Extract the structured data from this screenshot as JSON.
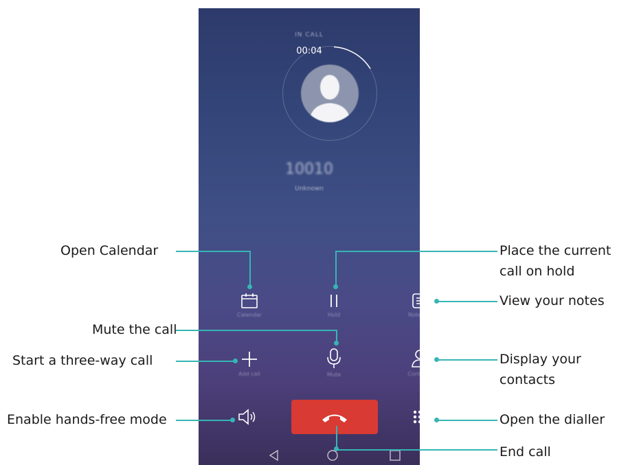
{
  "call": {
    "status": "IN CALL",
    "duration": "00:04",
    "number": "10010",
    "number_label": "Unknown"
  },
  "controls": {
    "calendar": {
      "label": "Calendar",
      "icon": "calendar-icon"
    },
    "hold": {
      "label": "Hold",
      "icon": "pause-icon"
    },
    "notepad": {
      "label": "Notepad",
      "icon": "notepad-icon"
    },
    "add_call": {
      "label": "Add call",
      "icon": "plus-icon"
    },
    "mute": {
      "label": "Mute",
      "icon": "microphone-icon"
    },
    "contacts": {
      "label": "Contacts",
      "icon": "person-icon"
    },
    "speaker": {
      "icon": "speaker-icon"
    },
    "end_call": {
      "icon": "phone-hangup-icon",
      "color": "#d93a33"
    },
    "dialpad": {
      "icon": "dialpad-icon"
    }
  },
  "annotations": {
    "open_calendar": "Open Calendar",
    "hold_line1": "Place the current",
    "hold_line2": "call on hold",
    "view_notes": "View your notes",
    "mute": "Mute the call",
    "three_way": "Start a three-way call",
    "contacts_line1": "Display your",
    "contacts_line2": "contacts",
    "hands_free": "Enable hands-free mode",
    "dialler": "Open the dialler",
    "end_call": "End call"
  },
  "colors": {
    "leader_line": "#37b5b5",
    "end_button": "#d93a33"
  }
}
